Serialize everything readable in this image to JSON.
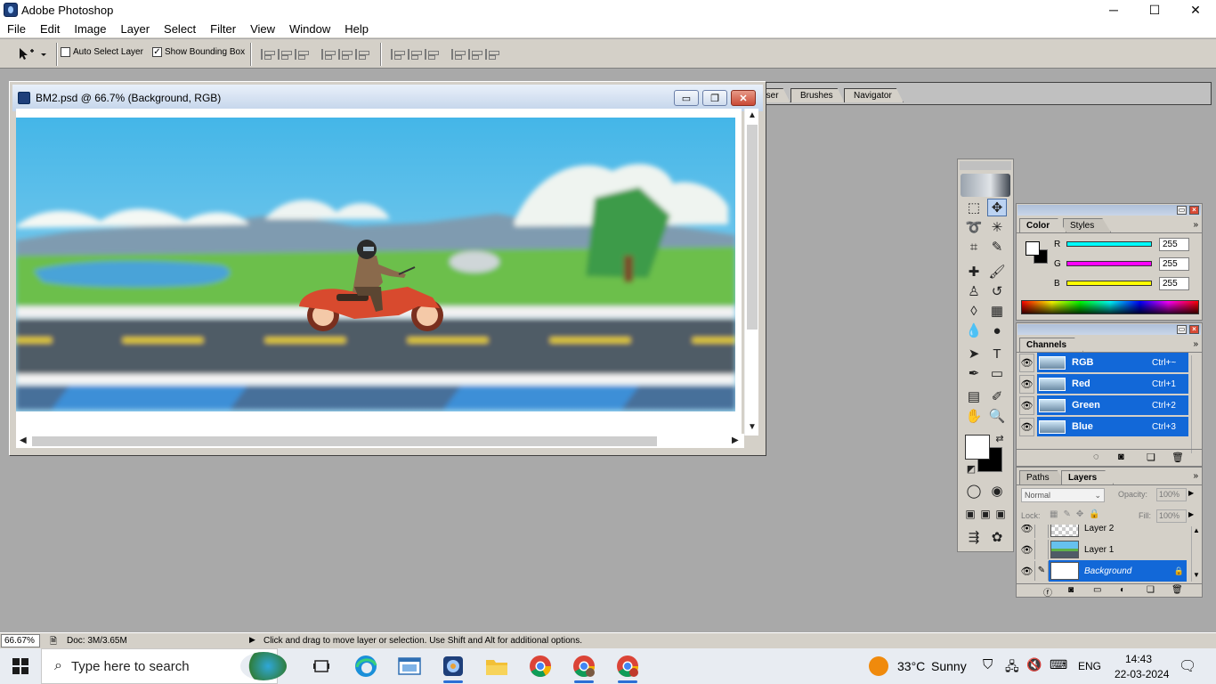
{
  "window": {
    "title": "Adobe Photoshop",
    "min": "─",
    "max": "☐",
    "close": "✕"
  },
  "menu": [
    "File",
    "Edit",
    "Image",
    "Layer",
    "Select",
    "Filter",
    "View",
    "Window",
    "Help"
  ],
  "options": {
    "auto_select_label": "Auto Select Layer",
    "auto_select_checked": false,
    "show_bbox_label": "Show Bounding Box",
    "show_bbox_checked": true,
    "check_mark": "✓"
  },
  "palette_well": {
    "tabs": [
      "File Browser",
      "Brushes",
      "Navigator"
    ]
  },
  "document": {
    "title": "BM2.psd @ 66.7% (Background, RGB)",
    "min": "▭",
    "restore": "❐",
    "close": "✕"
  },
  "toolbox": {
    "tools": [
      "marquee-icon",
      "move-icon",
      "lasso-icon",
      "magic-wand-icon",
      "crop-icon",
      "slice-icon",
      "healing-brush-icon",
      "brush-icon",
      "clone-stamp-icon",
      "history-brush-icon",
      "eraser-icon",
      "gradient-icon",
      "blur-icon",
      "dodge-icon",
      "path-select-icon",
      "type-icon",
      "pen-icon",
      "shape-icon",
      "notes-icon",
      "eyedropper-icon",
      "hand-icon",
      "zoom-icon"
    ],
    "active_tool": "move-icon"
  },
  "color_panel": {
    "tabs": [
      "Color",
      "Styles"
    ],
    "active_tab": "Color",
    "channels": [
      {
        "label": "R",
        "value": "255",
        "color": "#00e5ff"
      },
      {
        "label": "G",
        "value": "255",
        "color": "#ff00ff"
      },
      {
        "label": "B",
        "value": "255",
        "color": "#ffff00"
      }
    ]
  },
  "channels_panel": {
    "tab": "Channels",
    "rows": [
      {
        "name": "RGB",
        "shortcut": "Ctrl+~"
      },
      {
        "name": "Red",
        "shortcut": "Ctrl+1"
      },
      {
        "name": "Green",
        "shortcut": "Ctrl+2"
      },
      {
        "name": "Blue",
        "shortcut": "Ctrl+3"
      }
    ]
  },
  "layers_panel": {
    "tabs": [
      "Paths",
      "Layers"
    ],
    "active_tab": "Layers",
    "blend_mode": "Normal",
    "opacity_label": "Opacity:",
    "opacity": "100%",
    "lock_label": "Lock:",
    "fill_label": "Fill:",
    "fill": "100%",
    "layers": [
      "Layer 2",
      "Layer 1",
      "Background"
    ],
    "selected": "Background"
  },
  "status": {
    "zoom": "66.67%",
    "doc": "Doc: 3M/3.65M",
    "hint": "Click and drag to move layer or selection.  Use Shift and Alt for additional options."
  },
  "taskbar": {
    "search_placeholder": "Type here to search",
    "weather_temp": "33°C",
    "weather_text": "Sunny",
    "lang": "ENG",
    "time": "14:43",
    "date": "22-03-2024"
  }
}
